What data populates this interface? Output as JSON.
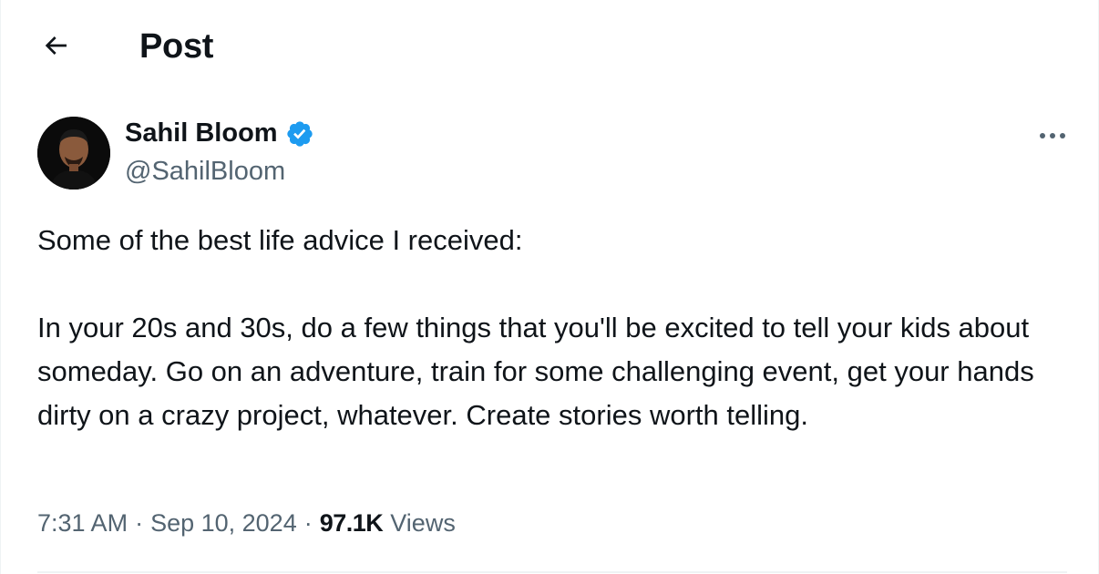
{
  "header": {
    "title": "Post",
    "back_icon": "arrow-left-icon"
  },
  "author": {
    "name": "Sahil Bloom",
    "handle": "@SahilBloom",
    "verified": true,
    "verified_color": "#1d9bf0"
  },
  "post": {
    "paragraphs": [
      "Some of the best life advice I received:",
      "In your 20s and 30s, do a few things that you'll be excited to tell your kids about someday. Go on an adventure, train for some challenging event, get your hands dirty on a crazy project, whatever. Create stories worth telling."
    ]
  },
  "meta": {
    "time": "7:31 AM",
    "date": "Sep 10, 2024",
    "separator": "·",
    "views_count": "97.1K",
    "views_label": "Views"
  },
  "colors": {
    "text_primary": "#0f1419",
    "text_secondary": "#536471",
    "accent": "#1d9bf0",
    "divider": "#eff3f4"
  }
}
